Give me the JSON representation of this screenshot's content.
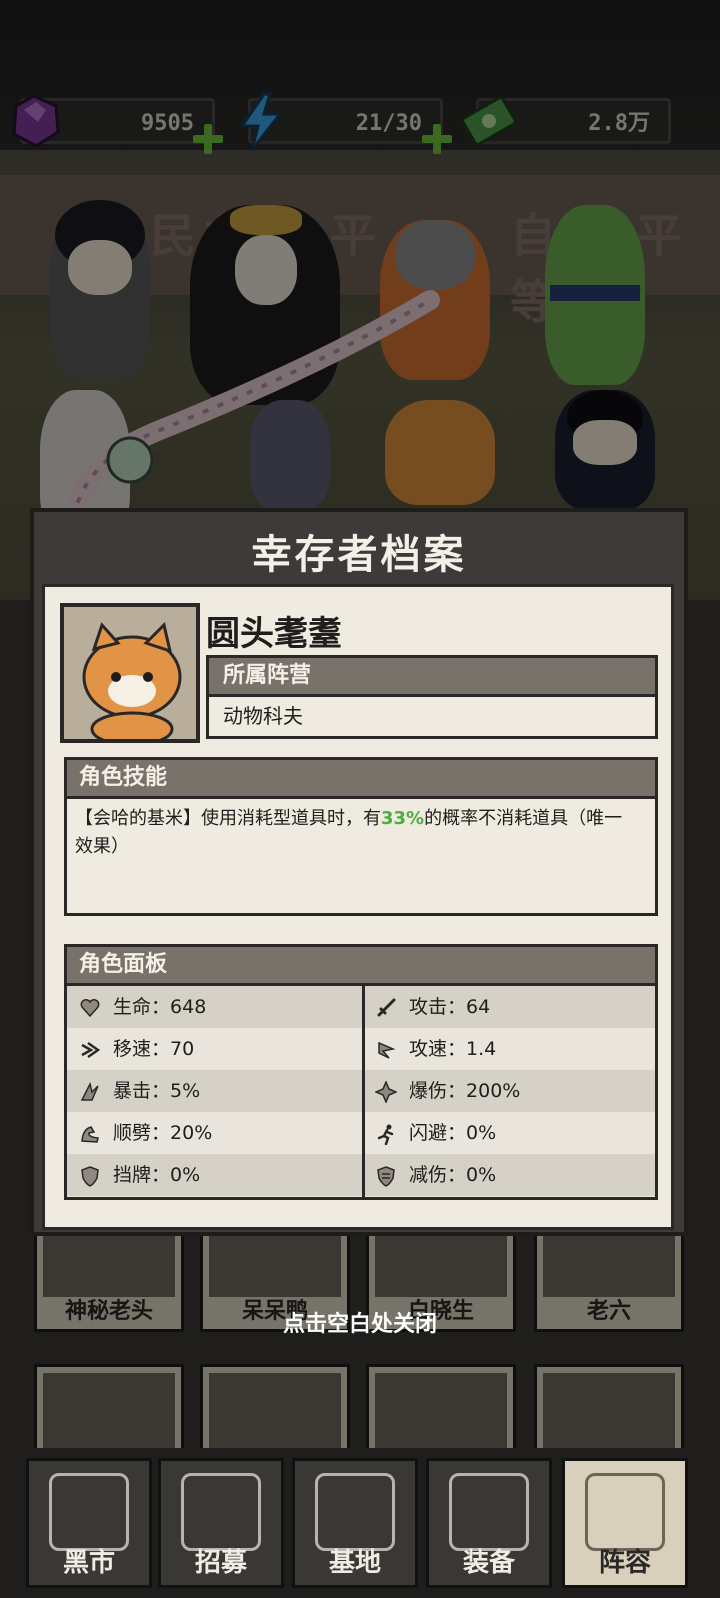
{
  "resources": {
    "gems": "9505",
    "energy": "21/30",
    "cash": "2.8万"
  },
  "scene": {
    "wall_text_left": "民主",
    "wall_text_mid": "平",
    "wall_text_right": "自由 平等"
  },
  "roster_behind": [
    {
      "name": "神秘老头"
    },
    {
      "name": "呆呆鸭"
    },
    {
      "name": "白晓生"
    },
    {
      "name": "老六"
    }
  ],
  "dialog": {
    "title": "幸存者档案",
    "character_name": "圆头耄耋",
    "faction_header": "所属阵营",
    "faction_value": "动物科夫",
    "skill_header": "角色技能",
    "skill_text_before": "【会哈的基米】使用消耗型道具时，有",
    "skill_percent": "33%",
    "skill_text_after": "的概率不消耗道具（唯一效果）",
    "panel_header": "角色面板",
    "stats": [
      {
        "icon": "heart-icon",
        "label": "生命：",
        "value": "648"
      },
      {
        "icon": "sword-icon",
        "label": "攻击：",
        "value": "64"
      },
      {
        "icon": "speed-icon",
        "label": "移速：",
        "value": "70"
      },
      {
        "icon": "attack-speed-icon",
        "label": "攻速：",
        "value": "1.4"
      },
      {
        "icon": "crit-icon",
        "label": "暴击：",
        "value": "5%"
      },
      {
        "icon": "crit-damage-icon",
        "label": "爆伤：",
        "value": "200%"
      },
      {
        "icon": "flex-icon",
        "label": "顺劈：",
        "value": "20%"
      },
      {
        "icon": "dodge-icon",
        "label": "闪避：",
        "value": "0%"
      },
      {
        "icon": "shield-icon",
        "label": "挡牌：",
        "value": "0%"
      },
      {
        "icon": "armor-icon",
        "label": "减伤：",
        "value": "0%"
      }
    ]
  },
  "close_hint": "点击空白处关闭",
  "nav": [
    {
      "label": "黑市",
      "icon": "black-market-icon"
    },
    {
      "label": "招募",
      "icon": "recruit-icon"
    },
    {
      "label": "基地",
      "icon": "base-icon"
    },
    {
      "label": "装备",
      "icon": "equipment-icon"
    },
    {
      "label": "阵容",
      "icon": "lineup-icon"
    }
  ],
  "colors": {
    "accent_green": "#4cae3e",
    "plus_green": "#6abf3a",
    "header_brown": "#79726a",
    "paper": "#efebe1"
  }
}
